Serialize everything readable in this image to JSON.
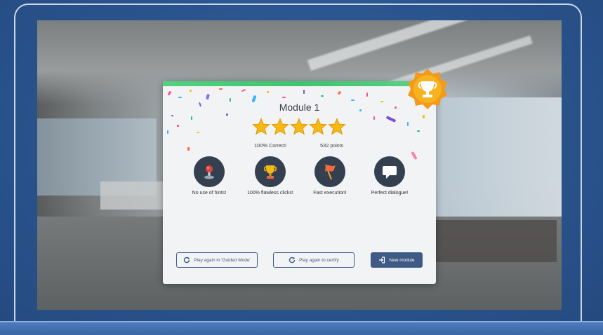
{
  "dialog": {
    "title": "Module 1",
    "stars_filled": 5,
    "stars_total": 5,
    "correct": {
      "value": "100%",
      "label": "Correct!"
    },
    "points": {
      "value": "532",
      "label": "points"
    },
    "achievements": [
      {
        "icon": "joystick-icon",
        "label": "No use of hints!"
      },
      {
        "icon": "trophy-icon",
        "label": "100% flawless clicks!"
      },
      {
        "icon": "flag-icon",
        "label": "Fast execution!"
      },
      {
        "icon": "speech-bubble-icon",
        "label": "Perfect dialogue!"
      }
    ],
    "buttons": {
      "guided": "Play again in 'Guided Mode'",
      "certify": "Play again to certify",
      "new_module": "New module"
    }
  },
  "colors": {
    "accent_green": "#4ccc7a",
    "button_blue": "#3f5a84",
    "star_gold": "#f5b915",
    "icon_circle": "#34404f",
    "badge_orange": "#f39a1b"
  }
}
